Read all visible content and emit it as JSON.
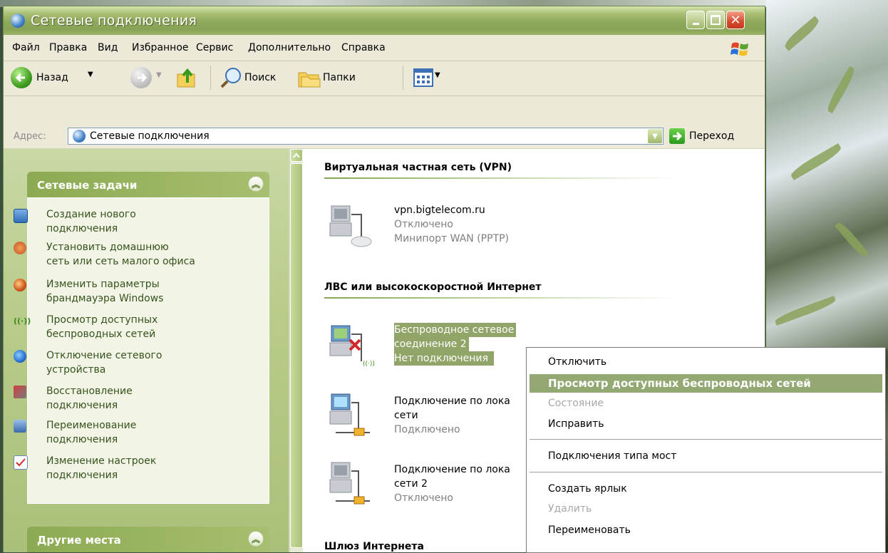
{
  "window": {
    "title": "Сетевые подключения"
  },
  "menubar": {
    "items": [
      "Файл",
      "Правка",
      "Вид",
      "Избранное",
      "Сервис",
      "Дополнительно",
      "Справка"
    ]
  },
  "toolbar": {
    "back": "Назад",
    "search": "Поиск",
    "folders": "Папки"
  },
  "address": {
    "label": "Адрес:",
    "value": "Сетевые подключения",
    "go": "Переход"
  },
  "left_panel": {
    "network_tasks": {
      "title": "Сетевые задачи",
      "items": [
        [
          "Создание нового",
          "подключения"
        ],
        [
          "Установить домашнюю",
          "сеть или сеть малого офиса"
        ],
        [
          "Изменить параметры",
          "брандмауэра Windows"
        ],
        [
          "Просмотр доступных",
          "беспроводных сетей"
        ],
        [
          "Отключение сетевого",
          "устройства"
        ],
        [
          "Восстановление",
          "подключения"
        ],
        [
          "Переименование",
          "подключения"
        ],
        [
          "Изменение настроек",
          "подключения"
        ]
      ]
    },
    "other_places": {
      "title": "Другие места"
    }
  },
  "content": {
    "groups": {
      "vpn": "Виртуальная частная сеть (VPN)",
      "lan": "ЛВС или высокоскоростной Интернет",
      "gateway": "Шлюз Интернета"
    },
    "connections": {
      "vpn": {
        "name": "vpn.bigtelecom.ru",
        "status": "Отключено",
        "device": "Минипорт WAN (PPTP)"
      },
      "wireless": {
        "name1": "Беспроводное сетевое",
        "name2": "соединение 2",
        "status": "Нет подключения"
      },
      "local1": {
        "name1": "Подключение по лока",
        "name2": "сети",
        "status": "Подключено"
      },
      "local2": {
        "name1": "Подключение по лока",
        "name2": "сети 2",
        "status": "Отключено"
      }
    }
  },
  "context_menu": {
    "items": [
      {
        "label": "Отключить",
        "enabled": true
      },
      {
        "label": "Просмотр доступных беспроводных сетей",
        "enabled": true,
        "selected": true
      },
      {
        "label": "Состояние",
        "enabled": false
      },
      {
        "label": "Исправить",
        "enabled": true
      },
      {
        "label": "Подключения типа мост",
        "enabled": true
      },
      {
        "label": "Создать ярлык",
        "enabled": true
      },
      {
        "label": "Удалить",
        "enabled": false
      },
      {
        "label": "Переименовать",
        "enabled": true
      }
    ]
  },
  "colors": {
    "accent": "#91a568",
    "task_text": "#36531d",
    "title_green": "#8ea85a"
  }
}
